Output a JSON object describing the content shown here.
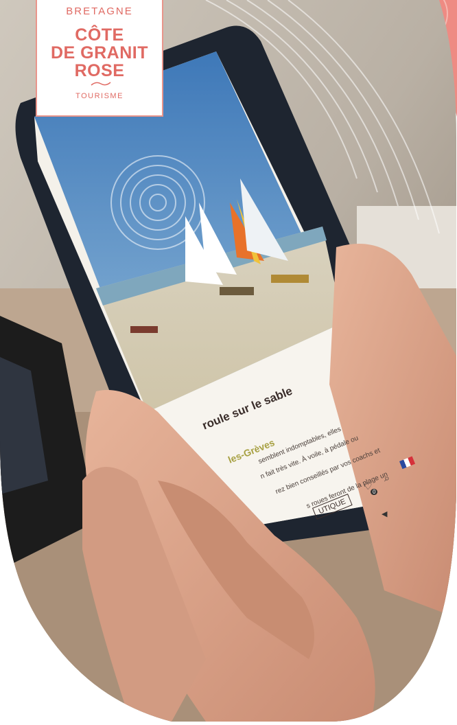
{
  "logo": {
    "top": "BRETAGNE",
    "line1": "CÔTE",
    "line2": "DE GRANIT",
    "line3": "ROSE",
    "sub": "TOURISME"
  },
  "phone": {
    "heading": "roule sur le sable",
    "subheading": "les-Grèves",
    "body": [
      "semblent indomptables, elles",
      "n fait très vite. À voile, à pédale ou",
      "rez bien conseillés par vos coachs et",
      "s roues feront de la plage un"
    ],
    "button": "UTIQUE",
    "badge": "0"
  },
  "colors": {
    "brand": "#e06a63",
    "heading": "#3a2d2a",
    "accent": "#a7a042"
  },
  "icons": [
    "heart-icon",
    "search-icon",
    "flag-icon",
    "back-triangle-icon"
  ]
}
